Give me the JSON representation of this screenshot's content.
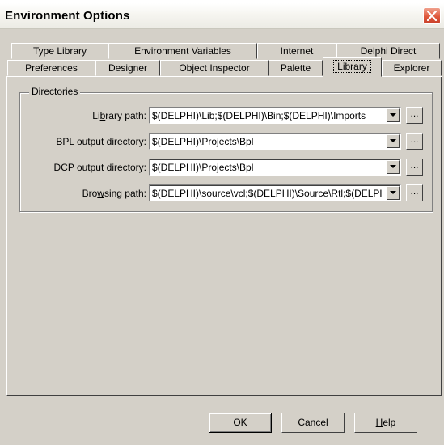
{
  "window": {
    "title": "Environment Options"
  },
  "tabs": {
    "back_row": [
      {
        "label": "Type Library"
      },
      {
        "label": "Environment Variables"
      },
      {
        "label": "Internet"
      },
      {
        "label": "Delphi Direct"
      }
    ],
    "front_row": [
      {
        "label": "Preferences"
      },
      {
        "label": "Designer"
      },
      {
        "label": "Object Inspector"
      },
      {
        "label": "Palette"
      },
      {
        "label": "Library",
        "selected": true
      },
      {
        "label": "Explorer"
      }
    ]
  },
  "directories": {
    "group_label": "Directories",
    "rows": [
      {
        "label_pre": "Li",
        "label_key": "b",
        "label_post": "rary path:",
        "value": "$(DELPHI)\\Lib;$(DELPHI)\\Bin;$(DELPHI)\\Imports",
        "button": "..."
      },
      {
        "label_pre": "BP",
        "label_key": "L",
        "label_post": " output directory:",
        "value": "$(DELPHI)\\Projects\\Bpl",
        "button": "..."
      },
      {
        "label_pre": "DCP output d",
        "label_key": "i",
        "label_post": "rectory:",
        "value": "$(DELPHI)\\Projects\\Bpl",
        "button": "..."
      },
      {
        "label_pre": "Bro",
        "label_key": "w",
        "label_post": "sing path:",
        "value": "$(DELPHI)\\source\\vcl;$(DELPHI)\\Source\\Rtl;$(DELPHI)",
        "button": "..."
      }
    ]
  },
  "buttons": {
    "ok": "OK",
    "cancel": "Cancel",
    "help_key": "H",
    "help_rest": "elp"
  }
}
